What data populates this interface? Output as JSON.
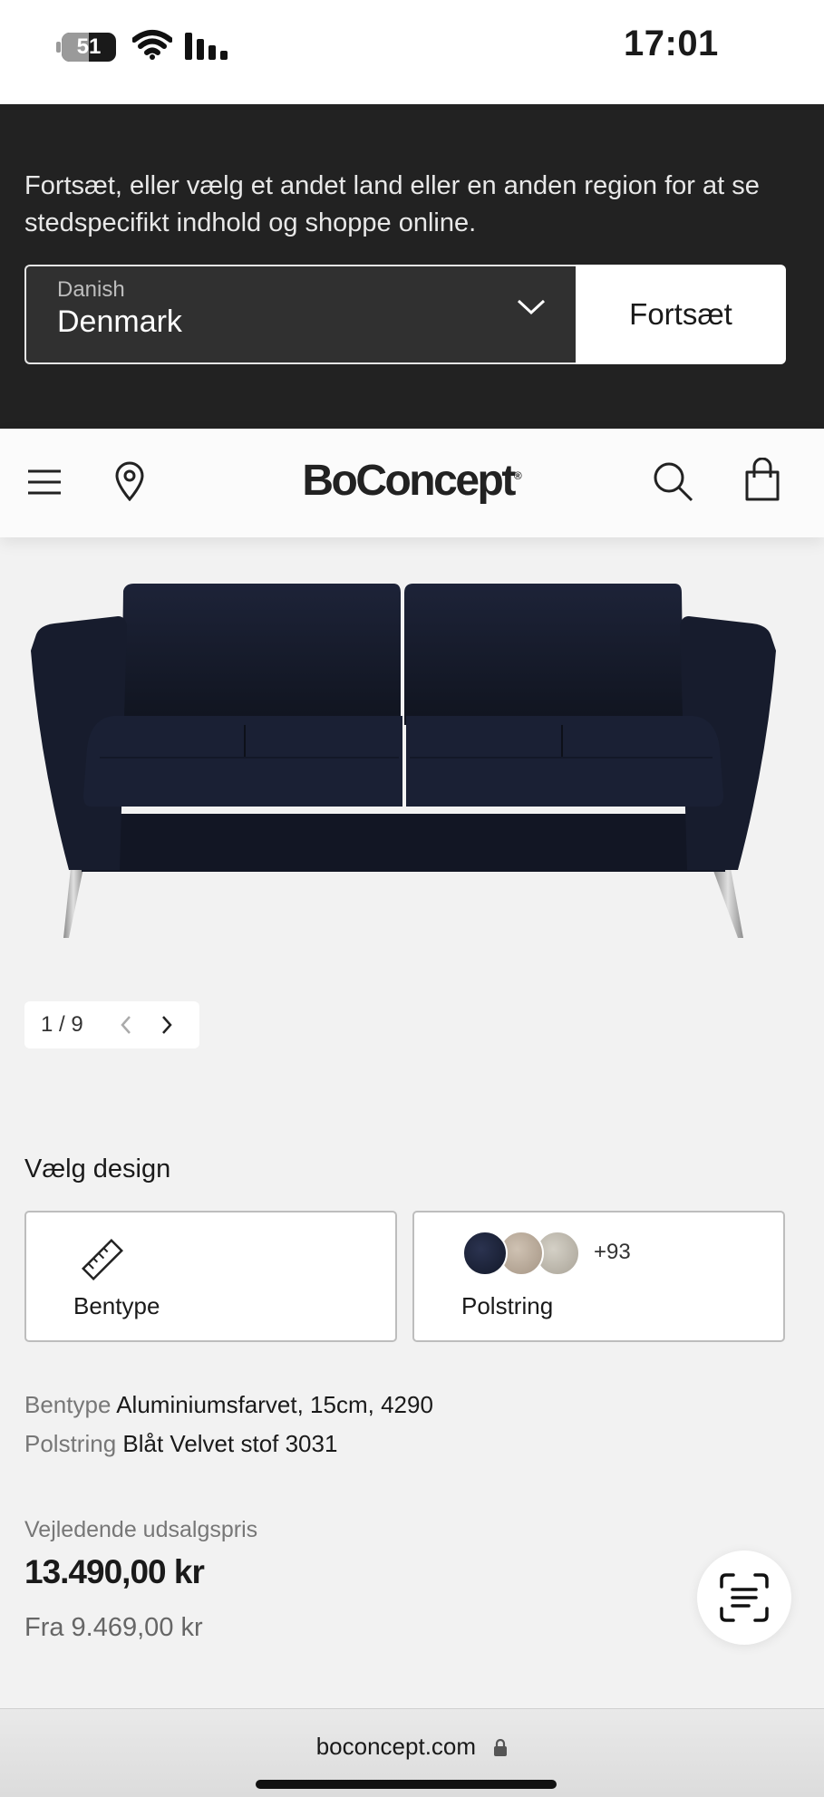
{
  "status_bar": {
    "time": "17:01",
    "battery_level": "51",
    "battery_icon": "battery-icon",
    "wifi_icon": "wifi-icon",
    "signal_icon": "cellular-signal-icon"
  },
  "region_banner": {
    "message": "Fortsæt, eller vælg et andet land eller en anden region for at se stedspecifikt indhold og shoppe online.",
    "select_language": "Danish",
    "select_country": "Denmark",
    "continue_label": "Fortsæt"
  },
  "header": {
    "logo": "BoConcept",
    "menu_icon": "hamburger-menu-icon",
    "location_icon": "location-pin-icon",
    "search_icon": "search-icon",
    "bag_icon": "shopping-bag-icon"
  },
  "gallery": {
    "pager": "1 / 9"
  },
  "design": {
    "title": "Vælg design",
    "leg_option_label": "Bentype",
    "upholstery_option_label": "Polstring",
    "more_swatches": "+93"
  },
  "specs": {
    "leg_key": "Bentype",
    "leg_value": "Aluminiumsfarvet, 15cm, 4290",
    "upholstery_key": "Polstring",
    "upholstery_value": "Blåt Velvet stof 3031"
  },
  "price": {
    "label": "Vejledende udsalgspris",
    "amount": "13.490,00 kr",
    "from": "Fra 9.469,00 kr"
  },
  "browser": {
    "url": "boconcept.com"
  },
  "colors": {
    "banner_bg": "#222222",
    "page_bg": "#f2f2f2",
    "sofa": "#161b2e"
  }
}
